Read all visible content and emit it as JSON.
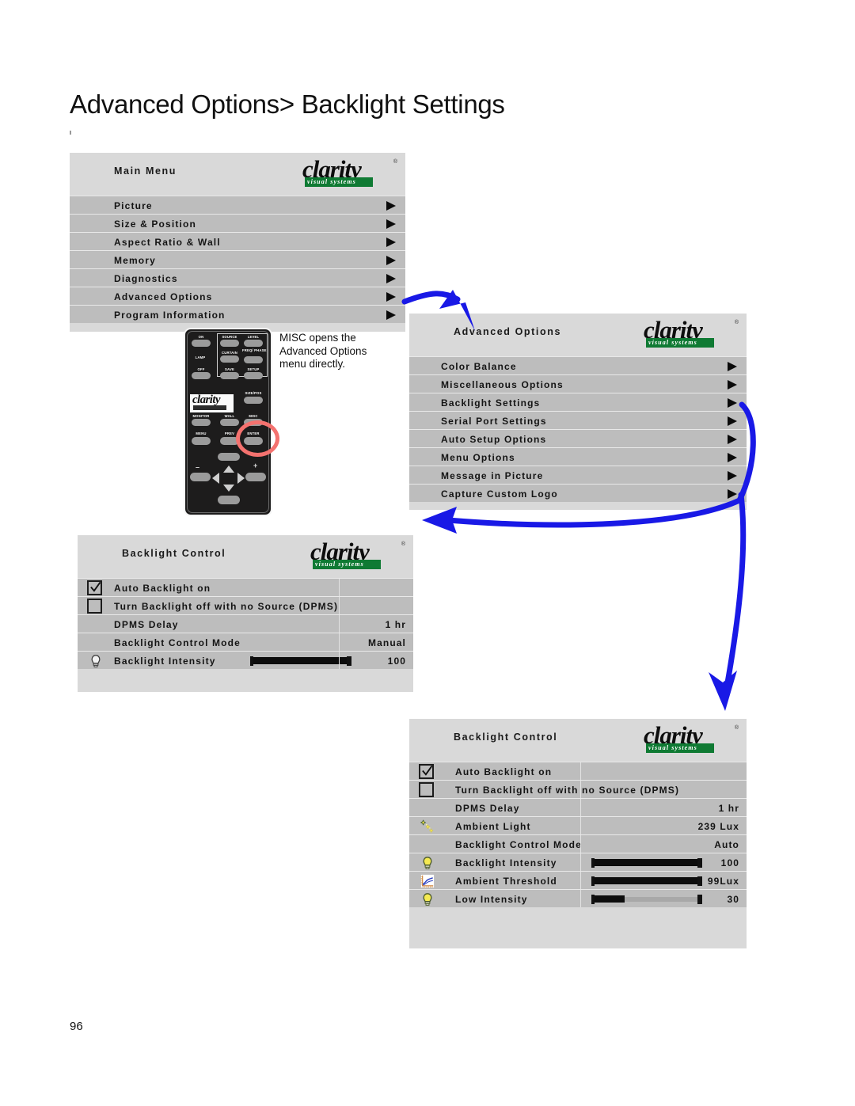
{
  "page": {
    "title": "Advanced Options> Backlight Settings",
    "number": "96"
  },
  "brand": {
    "name": "clarity",
    "tagline": "visual systems",
    "green": "#0f7a33"
  },
  "callout": {
    "text": "MISC opens the Advanced Options menu directly."
  },
  "remote": {
    "logo": "clarity",
    "buttons": [
      "ON",
      "SOURCE",
      "LEVEL",
      "LAMP",
      "CURTAIN",
      "FREQ/ PHASE",
      "OFF",
      "SAVE",
      "SETUP",
      "SIZE/POS",
      "MONITOR",
      "WALL",
      "MISC",
      "MENU",
      "PREV",
      "ENTER"
    ],
    "highlighted_button": "ENTER",
    "minus_label": "–",
    "plus_label": "+"
  },
  "main_menu": {
    "title": "Main Menu",
    "items": [
      {
        "label": "Picture"
      },
      {
        "label": "Size & Position"
      },
      {
        "label": "Aspect Ratio & Wall"
      },
      {
        "label": "Memory"
      },
      {
        "label": "Diagnostics"
      },
      {
        "label": "Advanced Options"
      },
      {
        "label": "Program Information"
      }
    ]
  },
  "advanced_options": {
    "title": "Advanced  Options",
    "items": [
      {
        "label": "Color Balance"
      },
      {
        "label": "Miscellaneous Options"
      },
      {
        "label": "Backlight Settings"
      },
      {
        "label": "Serial Port Settings"
      },
      {
        "label": "Auto Setup Options"
      },
      {
        "label": "Menu Options"
      },
      {
        "label": "Message in Picture"
      },
      {
        "label": "Capture Custom Logo"
      }
    ]
  },
  "backlight_manual": {
    "title": "Backlight Control",
    "rows": [
      {
        "label": "Auto Backlight on",
        "value": "",
        "checkbox": "checked"
      },
      {
        "label": "Turn Backlight off with no Source (DPMS)",
        "value": "",
        "checkbox": "unchecked"
      },
      {
        "label": "DPMS Delay",
        "value": "1 hr"
      },
      {
        "label": "Backlight Control Mode",
        "value": "Manual"
      },
      {
        "label": "Backlight Intensity",
        "value": "100",
        "icon": "bulb-gray-icon",
        "slider": 100
      }
    ]
  },
  "backlight_auto": {
    "title": "Backlight Control",
    "rows": [
      {
        "label": "Auto Backlight on",
        "value": "",
        "checkbox": "checked"
      },
      {
        "label": "Turn Backlight off with no Source (DPMS)",
        "value": "",
        "checkbox": "unchecked"
      },
      {
        "label": "DPMS Delay",
        "value": "1 hr"
      },
      {
        "label": "Ambient Light",
        "value": "239 Lux",
        "icon": "sparkles-icon"
      },
      {
        "label": "Backlight Control Mode",
        "value": "Auto"
      },
      {
        "label": "Backlight Intensity",
        "value": "100",
        "icon": "bulb-yellow-icon",
        "slider": 100
      },
      {
        "label": "Ambient Threshold",
        "value": "99Lux",
        "icon": "chart-icon",
        "slider": 99
      },
      {
        "label": "Low Intensity",
        "value": "30",
        "icon": "bulb-yellow-icon",
        "slider": 30
      }
    ]
  }
}
